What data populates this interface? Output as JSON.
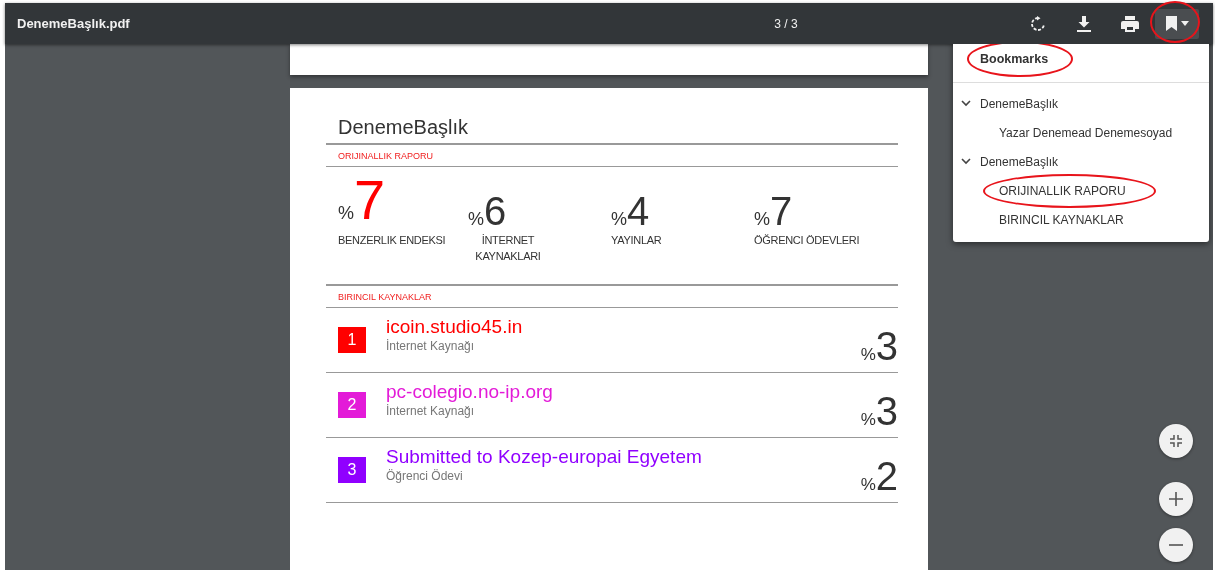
{
  "toolbar": {
    "title": "DenemeBaşlık.pdf",
    "page_indicator": "3 / 3",
    "bookmark_button_circled": true
  },
  "document": {
    "title": "DenemeBaşlık",
    "report_heading": "ORIJINALLIK RAPORU",
    "stats": [
      {
        "prefix": "%",
        "value": "7",
        "label": "BENZERLIK ENDEKSI",
        "highlight": true
      },
      {
        "prefix": "%",
        "value": "6",
        "label": "İNTERNET KAYNAKLARI",
        "highlight": false
      },
      {
        "prefix": "%",
        "value": "4",
        "label": "YAYINLAR",
        "highlight": false
      },
      {
        "prefix": "%",
        "value": "7",
        "label": "ÖĞRENCI ÖDEVLERI",
        "highlight": false
      }
    ],
    "sources_heading": "BIRINCIL KAYNAKLAR",
    "sources": [
      {
        "rank": "1",
        "name": "icoin.studio45.in",
        "type": "İnternet Kaynağı",
        "prefix": "%",
        "percent": "3",
        "color": "#ff0000"
      },
      {
        "rank": "2",
        "name": "pc-colegio.no-ip.org",
        "type": "İnternet Kaynağı",
        "prefix": "%",
        "percent": "3",
        "color": "#e31bd8"
      },
      {
        "rank": "3",
        "name": "Submitted to Kozep-europai Egyetem",
        "type": "Öğrenci Ödevi",
        "prefix": "%",
        "percent": "2",
        "color": "#9000ff"
      }
    ]
  },
  "bookmarks": {
    "title": "Bookmarks",
    "title_circled": true,
    "items": [
      {
        "label": "DenemeBaşlık",
        "expanded": true,
        "circled": false,
        "children": [
          {
            "label": "Yazar Denemead Denemesoyad",
            "circled": false
          }
        ]
      },
      {
        "label": "DenemeBaşlık",
        "expanded": true,
        "circled": false,
        "children": [
          {
            "label": "ORIJINALLIK RAPORU",
            "circled": true
          },
          {
            "label": "BIRINCIL KAYNAKLAR",
            "circled": false
          }
        ]
      }
    ]
  }
}
